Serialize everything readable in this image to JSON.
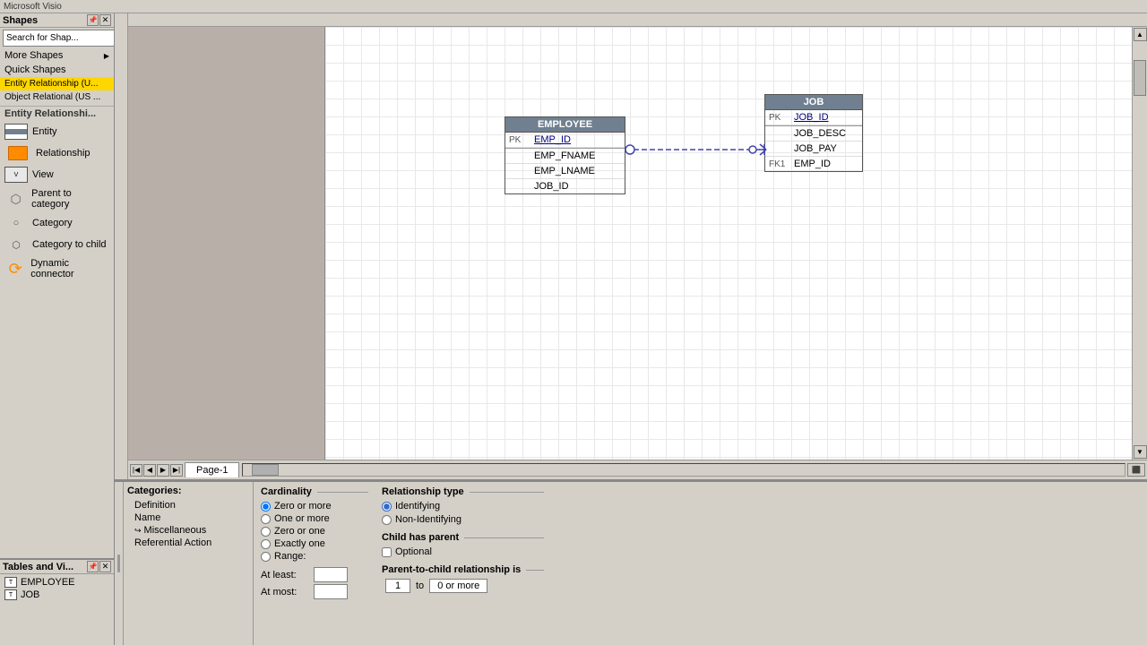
{
  "app": {
    "title": "Microsoft Visio"
  },
  "shapes_panel": {
    "title": "Shapes",
    "search_placeholder": "Search for Shap...",
    "menu_items": [
      {
        "id": "more-shapes",
        "label": "More Shapes",
        "has_arrow": true
      },
      {
        "id": "quick-shapes",
        "label": "Quick Shapes",
        "has_arrow": false
      },
      {
        "id": "entity-relationship",
        "label": "Entity Relationship (U...",
        "active": true
      },
      {
        "id": "object-relational",
        "label": "Object Relational (US ...",
        "active": false
      }
    ],
    "section_label": "Entity Relationshi...",
    "shapes": [
      {
        "id": "entity",
        "label": "Entity",
        "type": "entity"
      },
      {
        "id": "relationship",
        "label": "Relationship",
        "type": "relationship"
      },
      {
        "id": "view",
        "label": "View",
        "type": "view"
      },
      {
        "id": "parent-category",
        "label": "Parent to category",
        "type": "category"
      },
      {
        "id": "category",
        "label": "Category",
        "type": "category"
      },
      {
        "id": "category-child",
        "label": "Category to child",
        "type": "category"
      },
      {
        "id": "dynamic-connector",
        "label": "Dynamic connector",
        "type": "connector"
      }
    ]
  },
  "tables_panel": {
    "title": "Tables and Vi...",
    "tables": [
      {
        "id": "employee",
        "label": "EMPLOYEE"
      },
      {
        "id": "job",
        "label": "JOB"
      }
    ]
  },
  "diagram": {
    "employee_table": {
      "header": "EMPLOYEE",
      "pk_field": "EMP_ID",
      "pk_label": "PK",
      "fields": [
        "EMP_FNAME",
        "EMP_LNAME",
        "JOB_ID"
      ]
    },
    "job_table": {
      "header": "JOB",
      "pk_field": "JOB_ID",
      "pk_label": "PK",
      "fk_label": "FK1",
      "fields": [
        "JOB_DESC",
        "JOB_PAY",
        "EMP_ID"
      ]
    }
  },
  "bottom_panel": {
    "categories_title": "Categories:",
    "categories": [
      {
        "id": "definition",
        "label": "Definition",
        "indent": 1
      },
      {
        "id": "name",
        "label": "Name",
        "indent": 1
      },
      {
        "id": "miscellaneous",
        "label": "Miscellaneous",
        "indent": 2,
        "active": true
      },
      {
        "id": "referential-action",
        "label": "Referential Action",
        "indent": 1
      }
    ],
    "cardinality": {
      "title": "Cardinality",
      "options": [
        {
          "id": "zero-or-more",
          "label": "Zero or more",
          "selected": true
        },
        {
          "id": "one-or-more",
          "label": "One or more",
          "selected": false
        },
        {
          "id": "zero-or-one",
          "label": "Zero or one",
          "selected": false
        },
        {
          "id": "exactly-one",
          "label": "Exactly one",
          "selected": false
        },
        {
          "id": "range",
          "label": "Range:",
          "selected": false
        }
      ],
      "range": {
        "at_least_label": "At least:",
        "at_most_label": "At most:"
      }
    },
    "relationship_type": {
      "title": "Relationship type",
      "options": [
        {
          "id": "identifying",
          "label": "Identifying",
          "selected": true
        },
        {
          "id": "non-identifying",
          "label": "Non-Identifying",
          "selected": false
        }
      ]
    },
    "child_has_parent": {
      "title": "Child has parent",
      "options": [
        {
          "id": "optional",
          "label": "Optional",
          "checked": false
        }
      ]
    },
    "parent_to_child": {
      "title": "Parent-to-child relationship is",
      "display": "1  to  0 or more"
    }
  },
  "page_tabs": {
    "active_tab": "Page-1"
  }
}
